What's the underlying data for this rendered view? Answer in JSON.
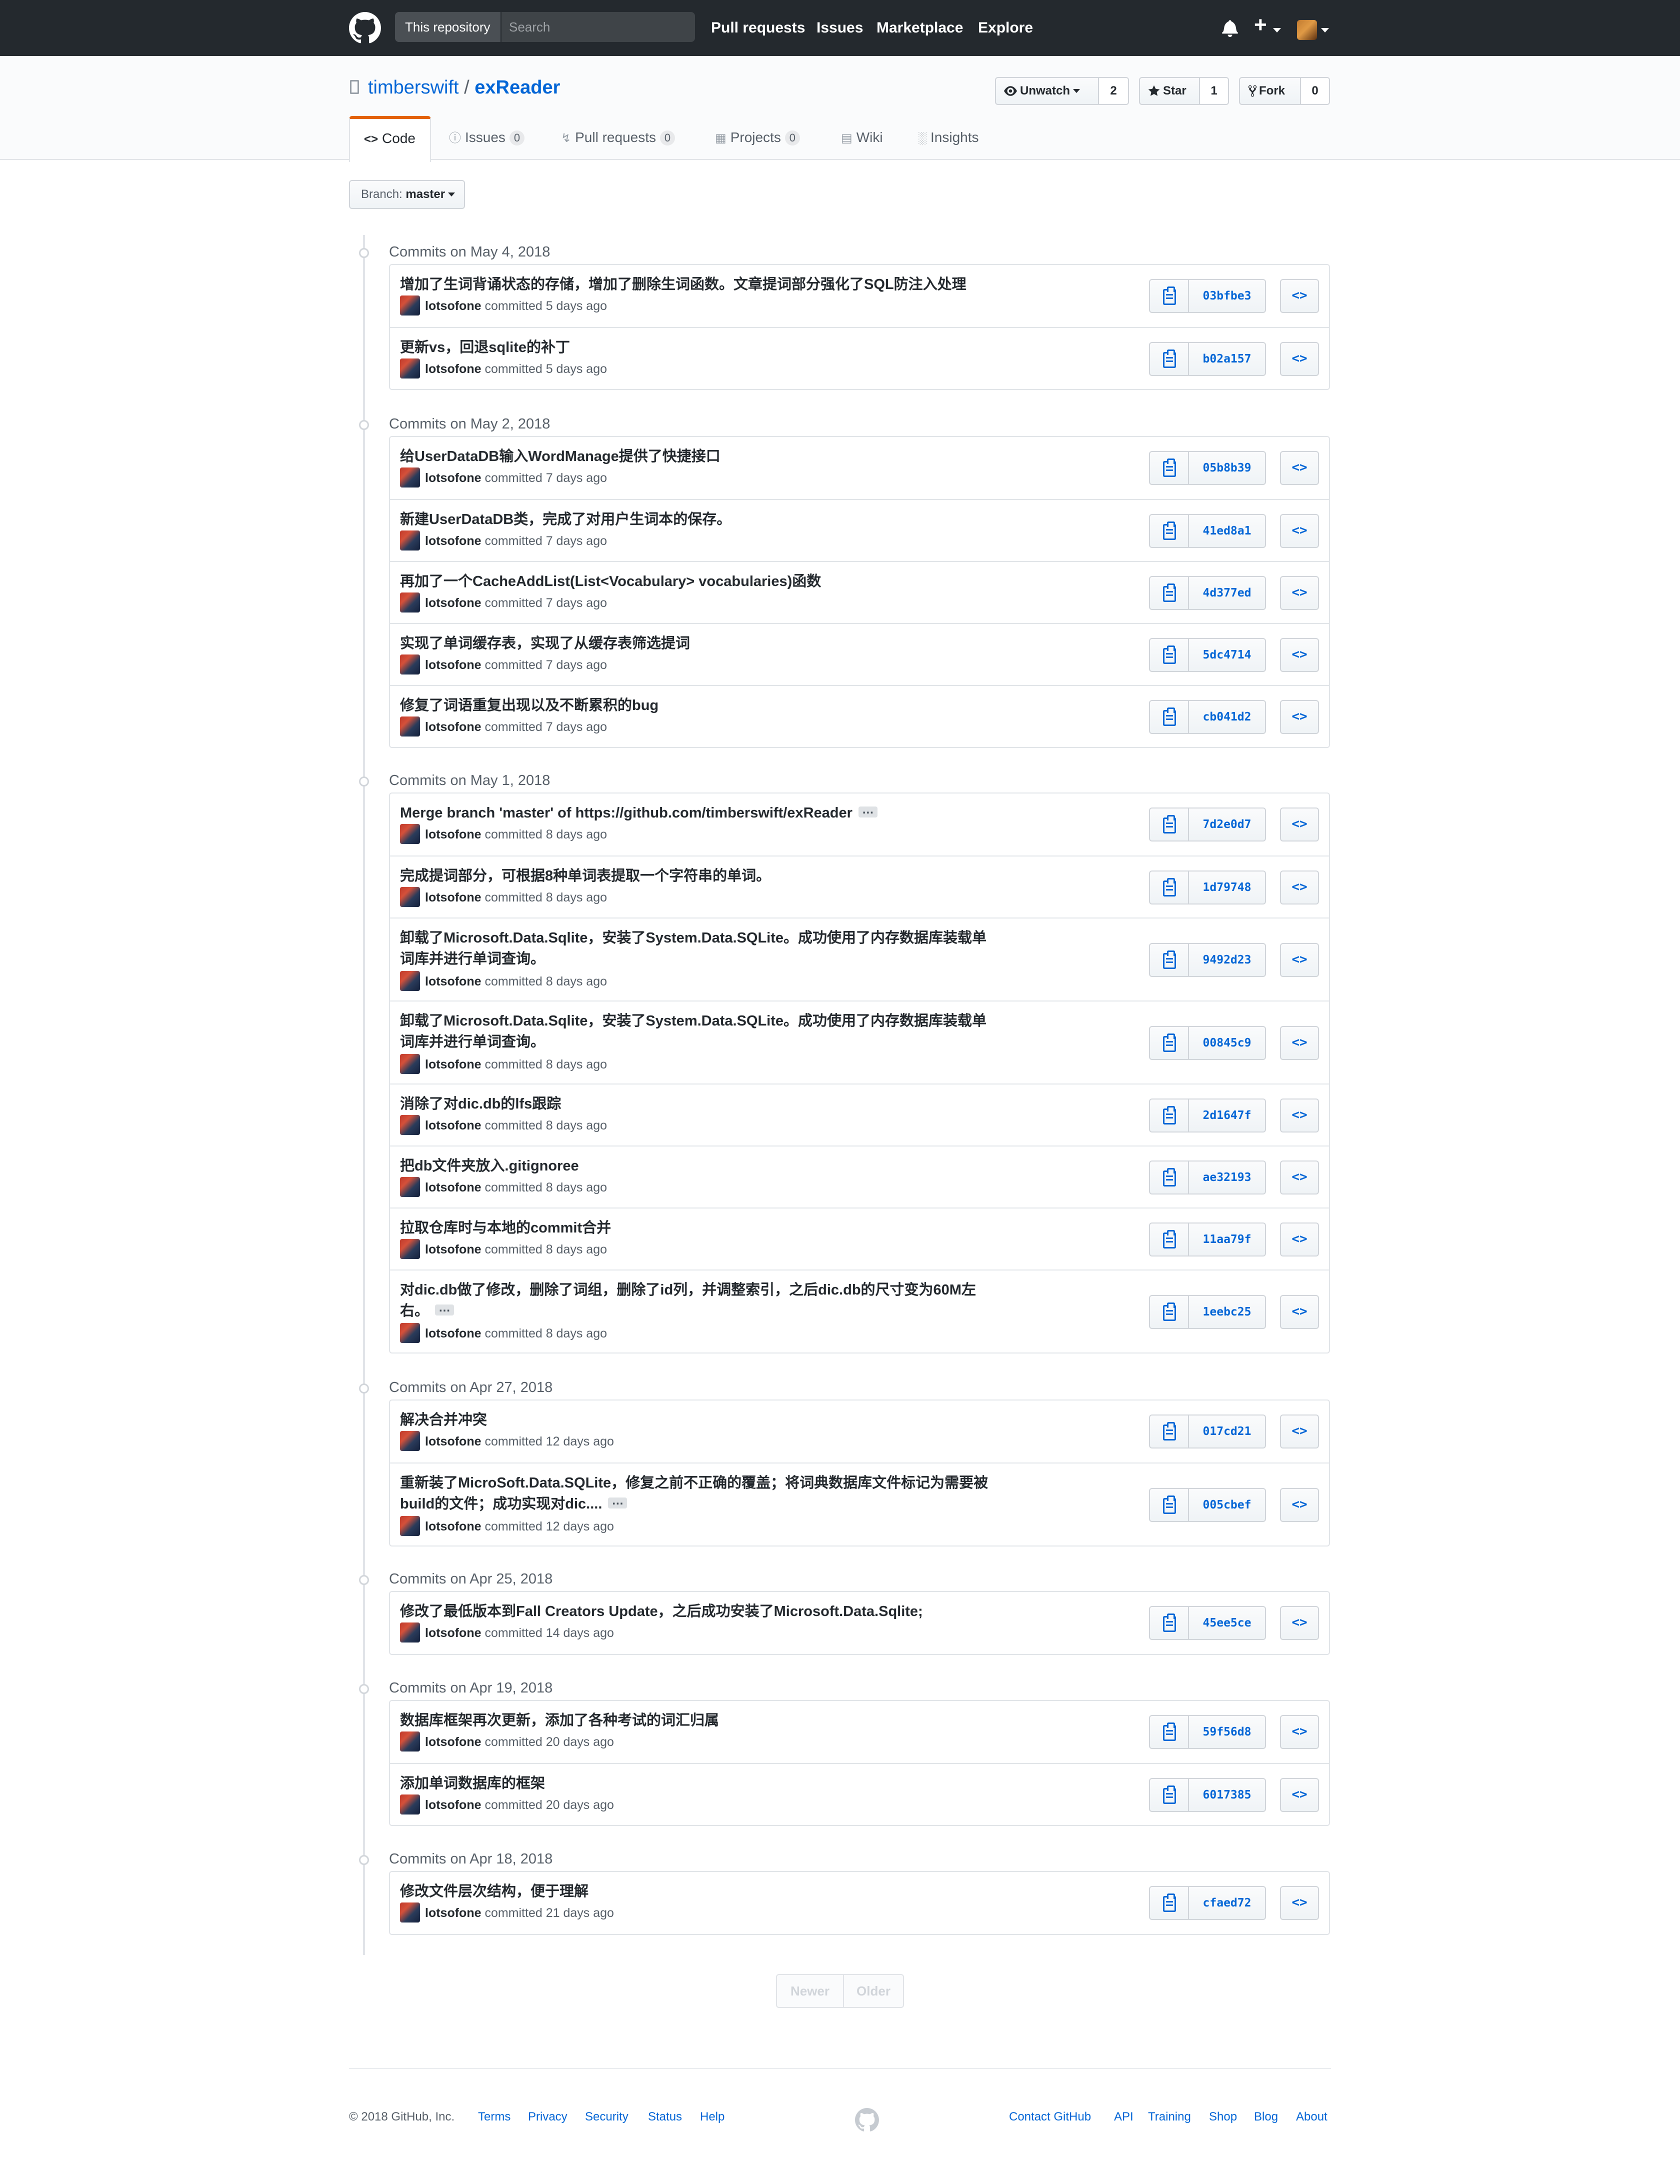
{
  "header": {
    "scope_label": "This repository",
    "search_placeholder": "Search",
    "nav": [
      "Pull requests",
      "Issues",
      "Marketplace",
      "Explore"
    ]
  },
  "repo": {
    "owner": "timberswift",
    "separator": "/",
    "name": "exReader",
    "actions": {
      "watch_label": "Unwatch",
      "watch_count": "2",
      "star_label": "Star",
      "star_count": "1",
      "fork_label": "Fork",
      "fork_count": "0"
    },
    "tabs": [
      {
        "label": "Code",
        "counter": ""
      },
      {
        "label": "Issues",
        "counter": "0"
      },
      {
        "label": "Pull requests",
        "counter": "0"
      },
      {
        "label": "Projects",
        "counter": "0"
      },
      {
        "label": "Wiki",
        "counter": ""
      },
      {
        "label": "Insights",
        "counter": ""
      }
    ]
  },
  "branch": {
    "prefix": "Branch:",
    "name": "master"
  },
  "commit_groups": [
    {
      "title": "Commits on May 4, 2018",
      "commits": [
        {
          "message": "增加了生词背诵状态的存储，增加了删除生词函数。文章提词部分强化了SQL防注入处理",
          "author": "lotsofone",
          "time": "committed 5 days ago",
          "sha": "03bfbe3"
        },
        {
          "message": "更新vs，回退sqlite的补丁",
          "author": "lotsofone",
          "time": "committed 5 days ago",
          "sha": "b02a157"
        }
      ]
    },
    {
      "title": "Commits on May 2, 2018",
      "commits": [
        {
          "message": "给UserDataDB输入WordManage提供了快捷接口",
          "author": "lotsofone",
          "time": "committed 7 days ago",
          "sha": "05b8b39"
        },
        {
          "message": "新建UserDataDB类，完成了对用户生词本的保存。",
          "author": "lotsofone",
          "time": "committed 7 days ago",
          "sha": "41ed8a1"
        },
        {
          "message": "再加了一个CacheAddList(List<Vocabulary> vocabularies)函数",
          "author": "lotsofone",
          "time": "committed 7 days ago",
          "sha": "4d377ed"
        },
        {
          "message": "实现了单词缓存表，实现了从缓存表筛选提词",
          "author": "lotsofone",
          "time": "committed 7 days ago",
          "sha": "5dc4714"
        },
        {
          "message": "修复了词语重复出现以及不断累积的bug",
          "author": "lotsofone",
          "time": "committed 7 days ago",
          "sha": "cb041d2"
        }
      ]
    },
    {
      "title": "Commits on May 1, 2018",
      "commits": [
        {
          "message": "Merge branch 'master' of https://github.com/timberswift/exReader",
          "author": "lotsofone",
          "time": "committed 8 days ago",
          "sha": "7d2e0d7"
        },
        {
          "message": "完成提词部分，可根据8种单词表提取一个字符串的单词。",
          "author": "lotsofone",
          "time": "committed 8 days ago",
          "sha": "1d79748"
        },
        {
          "message": "卸载了Microsoft.Data.Sqlite，安装了System.Data.SQLite。成功使用了内存数据库装载单词库并进行单词查询。",
          "author": "lotsofone",
          "time": "committed 8 days ago",
          "sha": "9492d23"
        },
        {
          "message": "卸载了Microsoft.Data.Sqlite，安装了System.Data.SQLite。成功使用了内存数据库装载单词库并进行单词查询。",
          "author": "lotsofone",
          "time": "committed 8 days ago",
          "sha": "00845c9"
        },
        {
          "message": "消除了对dic.db的lfs跟踪",
          "author": "lotsofone",
          "time": "committed 8 days ago",
          "sha": "2d1647f"
        },
        {
          "message": "把db文件夹放入.gitignoree",
          "author": "lotsofone",
          "time": "committed 8 days ago",
          "sha": "ae32193"
        },
        {
          "message": "拉取仓库时与本地的commit合并",
          "author": "lotsofone",
          "time": "committed 8 days ago",
          "sha": "11aa79f"
        },
        {
          "message": "对dic.db做了修改，删除了词组，删除了id列，并调整索引，之后dic.db的尺寸变为60M左右。",
          "author": "lotsofone",
          "time": "committed 8 days ago",
          "sha": "1eebc25"
        }
      ]
    },
    {
      "title": "Commits on Apr 27, 2018",
      "commits": [
        {
          "message": "解决合并冲突",
          "author": "lotsofone",
          "time": "committed 12 days ago",
          "sha": "017cd21"
        },
        {
          "message": "重新装了MicroSoft.Data.SQLite，修复之前不正确的覆盖；将词典数据库文件标记为需要被build的文件；成功实现对dic....",
          "author": "lotsofone",
          "time": "committed 12 days ago",
          "sha": "005cbef"
        }
      ]
    },
    {
      "title": "Commits on Apr 25, 2018",
      "commits": [
        {
          "message": "修改了最低版本到Fall Creators Update，之后成功安装了Microsoft.Data.Sqlite;",
          "author": "lotsofone",
          "time": "committed 14 days ago",
          "sha": "45ee5ce"
        }
      ]
    },
    {
      "title": "Commits on Apr 19, 2018",
      "commits": [
        {
          "message": "数据库框架再次更新，添加了各种考试的词汇归属",
          "author": "lotsofone",
          "time": "committed 20 days ago",
          "sha": "59f56d8"
        },
        {
          "message": "添加单词数据库的框架",
          "author": "lotsofone",
          "time": "committed 20 days ago",
          "sha": "6017385"
        }
      ]
    },
    {
      "title": "Commits on Apr 18, 2018",
      "commits": [
        {
          "message": "修改文件层次结构，便于理解",
          "author": "lotsofone",
          "time": "committed 21 days ago",
          "sha": "cfaed72"
        }
      ]
    }
  ],
  "pagination": {
    "newer": "Newer",
    "older": "Older"
  },
  "footer": {
    "copyright": "© 2018 GitHub, Inc.",
    "left_links": [
      "Terms",
      "Privacy",
      "Security",
      "Status",
      "Help"
    ],
    "right_links": [
      "Contact GitHub",
      "API",
      "Training",
      "Shop",
      "Blog",
      "About"
    ]
  },
  "colors": {
    "header_bg": "#24292e",
    "link": "#0366d6",
    "selected_tab_accent": "#e36209",
    "border": "#e1e4e8"
  },
  "icons": [
    "github-logo-icon",
    "bell-icon",
    "plus-icon",
    "eye-icon",
    "star-icon",
    "fork-icon",
    "repo-icon",
    "code-icon",
    "issue-icon",
    "pull-request-icon",
    "project-icon",
    "wiki-icon",
    "graph-icon",
    "clipboard-icon",
    "browse-code-icon"
  ]
}
